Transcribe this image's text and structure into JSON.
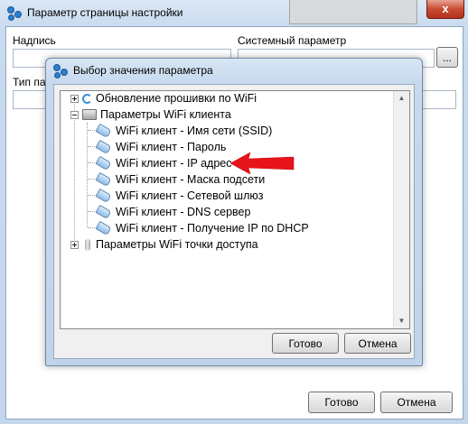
{
  "outer": {
    "title": "Параметр страницы настройки",
    "close_symbol": "x",
    "label_caption": "Надпись",
    "label_system_param": "Системный параметр",
    "label_param_type": "Тип параметра",
    "browse_label": "...",
    "ok_label": "Готово",
    "cancel_label": "Отмена"
  },
  "dialog": {
    "title": "Выбор значения параметра",
    "ok_label": "Готово",
    "cancel_label": "Отмена",
    "tree": [
      {
        "label": "Обновление прошивки по WiFi",
        "level": 0,
        "expander": "plus",
        "icon": "refresh-icon"
      },
      {
        "label": "Параметры WiFi клиента",
        "level": 0,
        "expander": "minus",
        "icon": "folder-icon"
      },
      {
        "label": "WiFi клиент - Имя сети (SSID)",
        "level": 1,
        "icon": "tag-icon"
      },
      {
        "label": "WiFi клиент - Пароль",
        "level": 1,
        "icon": "tag-icon"
      },
      {
        "label": "WiFi клиент - IP адрес",
        "level": 1,
        "icon": "tag-icon"
      },
      {
        "label": "WiFi клиент - Маска подсети",
        "level": 1,
        "icon": "tag-icon"
      },
      {
        "label": "WiFi клиент - Сетевой шлюз",
        "level": 1,
        "icon": "tag-icon"
      },
      {
        "label": "WiFi клиент - DNS сервер",
        "level": 1,
        "icon": "tag-icon"
      },
      {
        "label": "WiFi клиент - Получение IP по DHCP",
        "level": 1,
        "icon": "tag-icon"
      },
      {
        "label": "Параметры WiFi точки доступа",
        "level": 0,
        "expander": "plus",
        "icon": "wrench-icon"
      }
    ]
  },
  "colors": {
    "arrow": "#e8141b",
    "close_button": "#c84b34",
    "window_frame": "#c3d6eb"
  }
}
